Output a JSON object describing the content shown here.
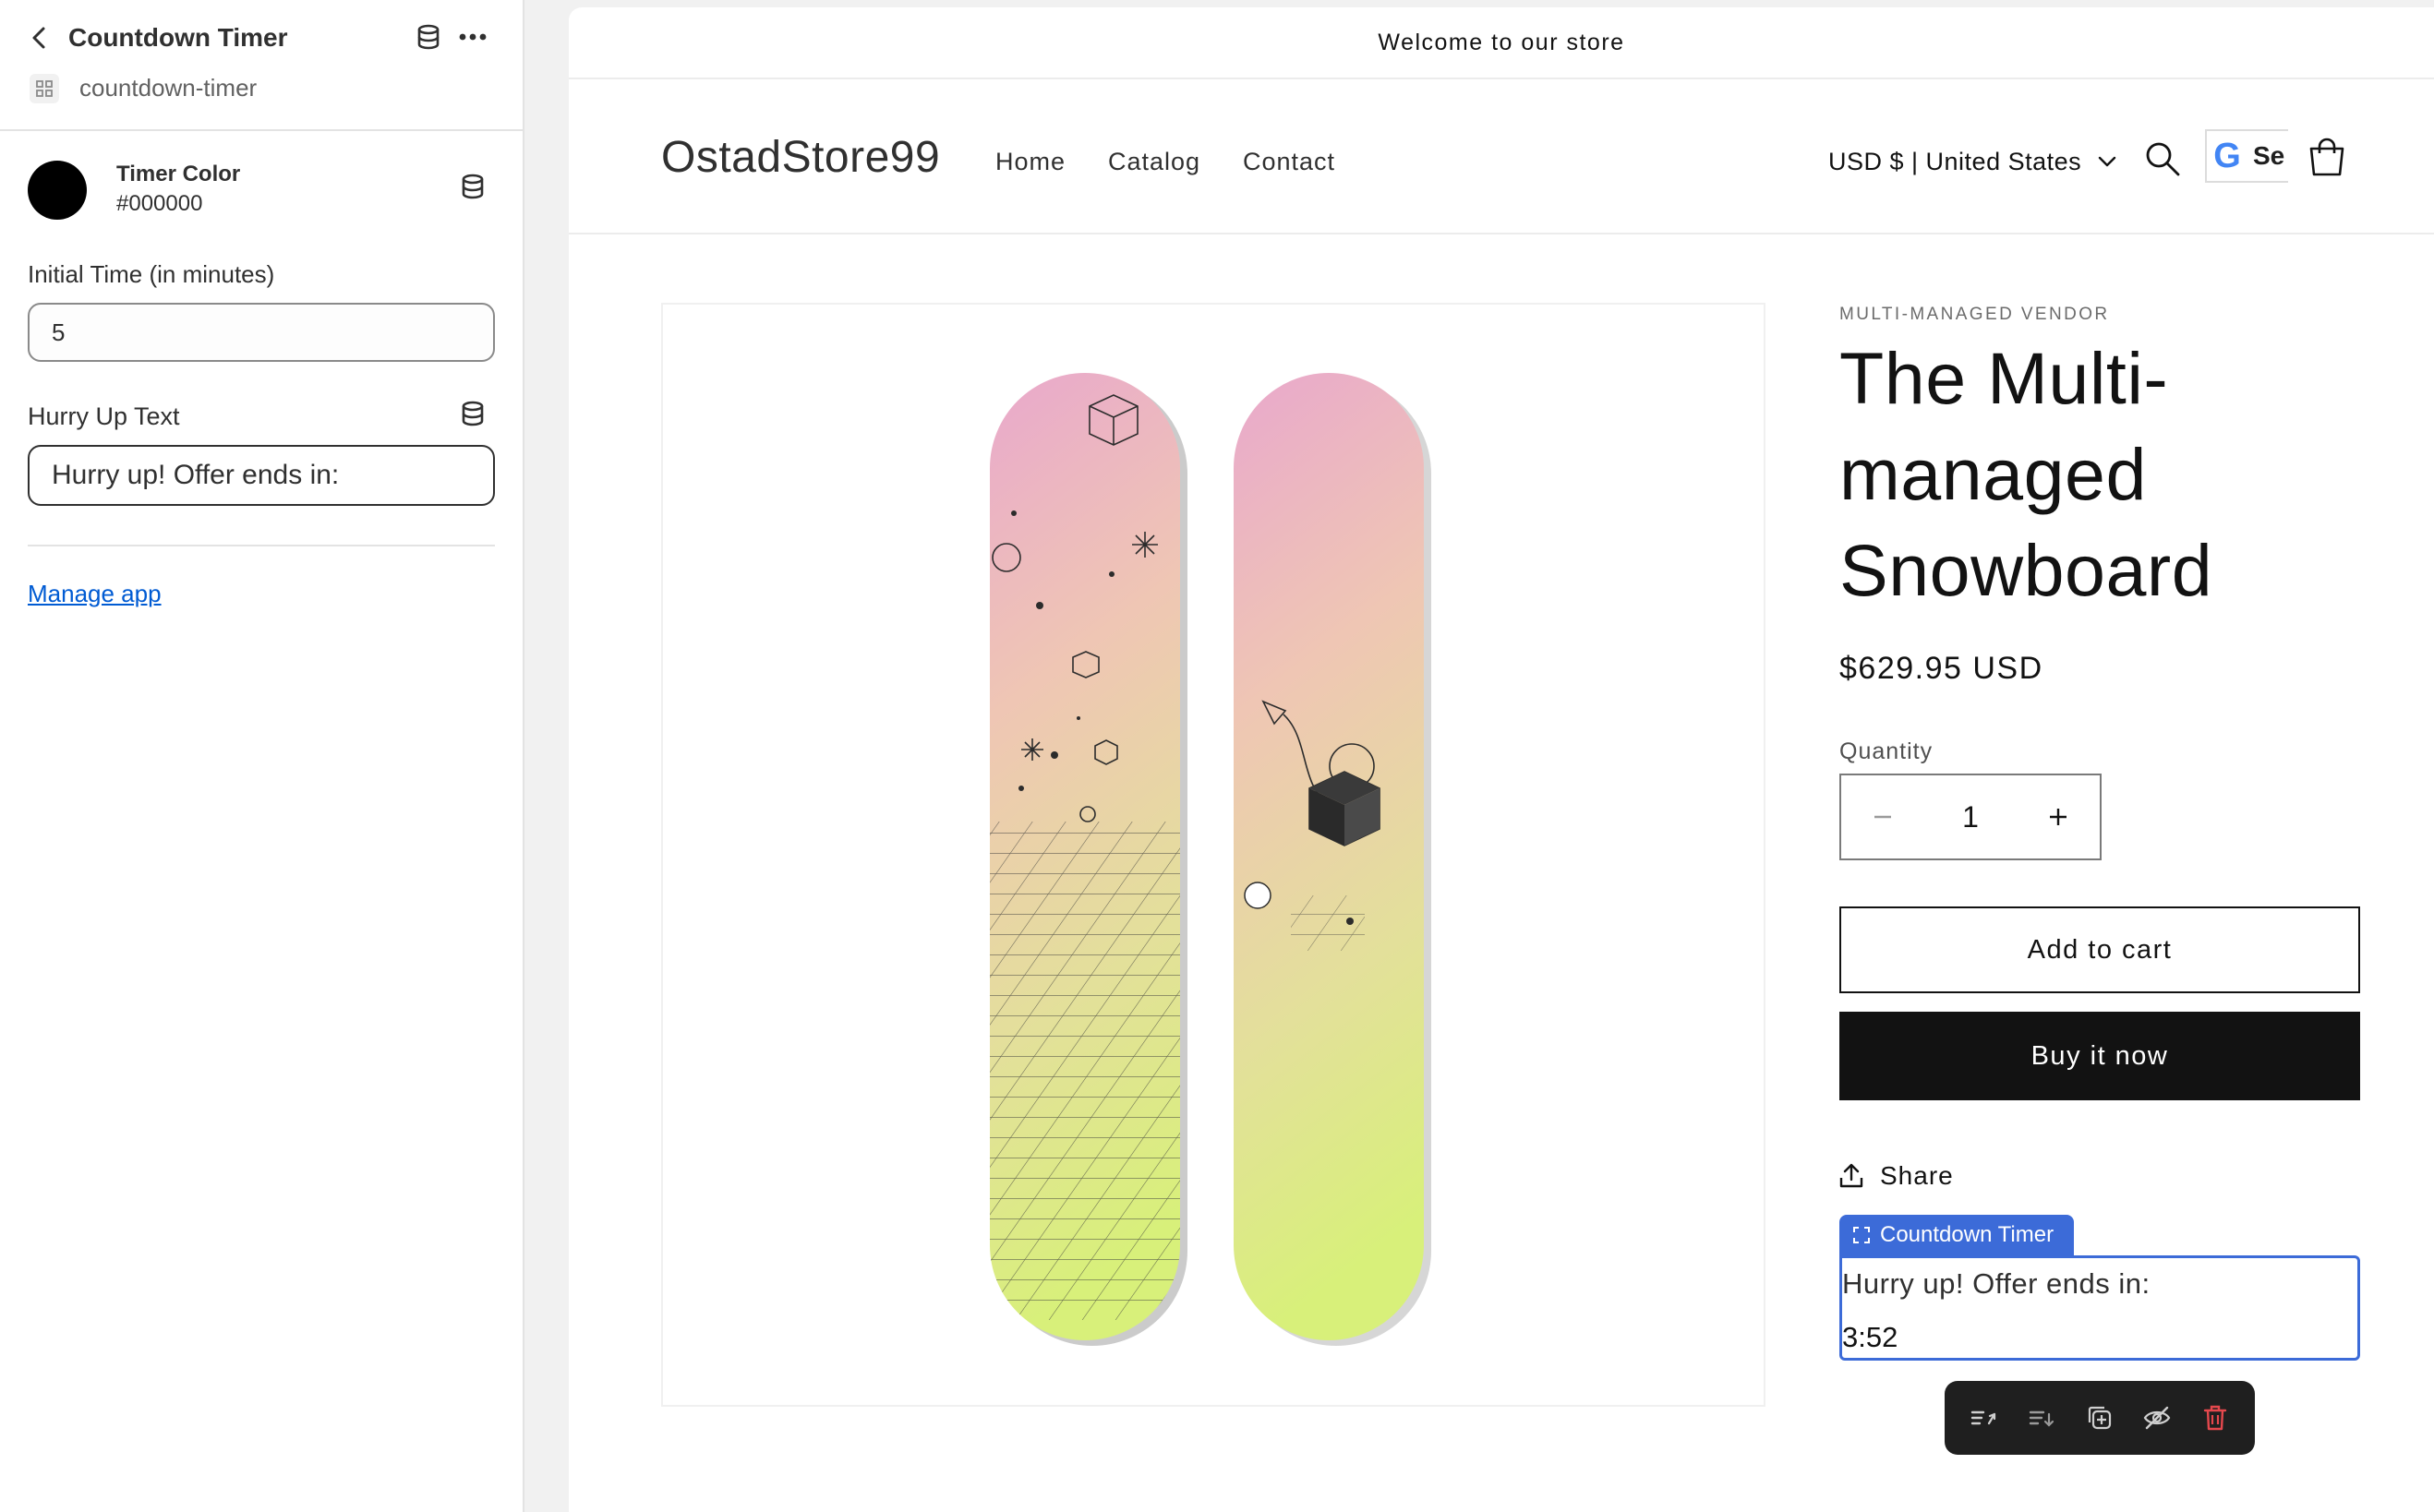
{
  "sidebar": {
    "title": "Countdown Timer",
    "subtitle": "countdown-timer",
    "timer_color": {
      "label": "Timer Color",
      "value": "#000000"
    },
    "initial_time": {
      "label": "Initial Time (in minutes)",
      "value": "5"
    },
    "hurry_text": {
      "label": "Hurry Up Text",
      "value": "Hurry up! Offer ends in:"
    },
    "manage_link": "Manage app"
  },
  "store": {
    "announcement": "Welcome to our store",
    "logo": "OstadStore99",
    "nav": [
      "Home",
      "Catalog",
      "Contact"
    ],
    "currency": "USD $ | United States",
    "google_button": {
      "letter": "G",
      "text": "Se"
    }
  },
  "product": {
    "vendor": "MULTI-MANAGED VENDOR",
    "title": "The Multi-managed Snowboard",
    "price": "$629.95 USD",
    "quantity_label": "Quantity",
    "quantity": "1",
    "add_to_cart": "Add to cart",
    "buy_now": "Buy it now",
    "share": "Share"
  },
  "app_block": {
    "tag_label": "Countdown Timer",
    "hurry_text": "Hurry up! Offer ends in:",
    "time_remaining": "3:52"
  },
  "toolbar": {
    "icons": [
      "move-up-icon",
      "move-down-icon",
      "duplicate-icon",
      "hide-icon",
      "delete-icon"
    ]
  },
  "colors": {
    "accent_blue": "#3c6bd8",
    "link_blue": "#005bd3",
    "buy_button": "#121212",
    "delete_red": "#e5484d",
    "timer_color": "#000000"
  }
}
